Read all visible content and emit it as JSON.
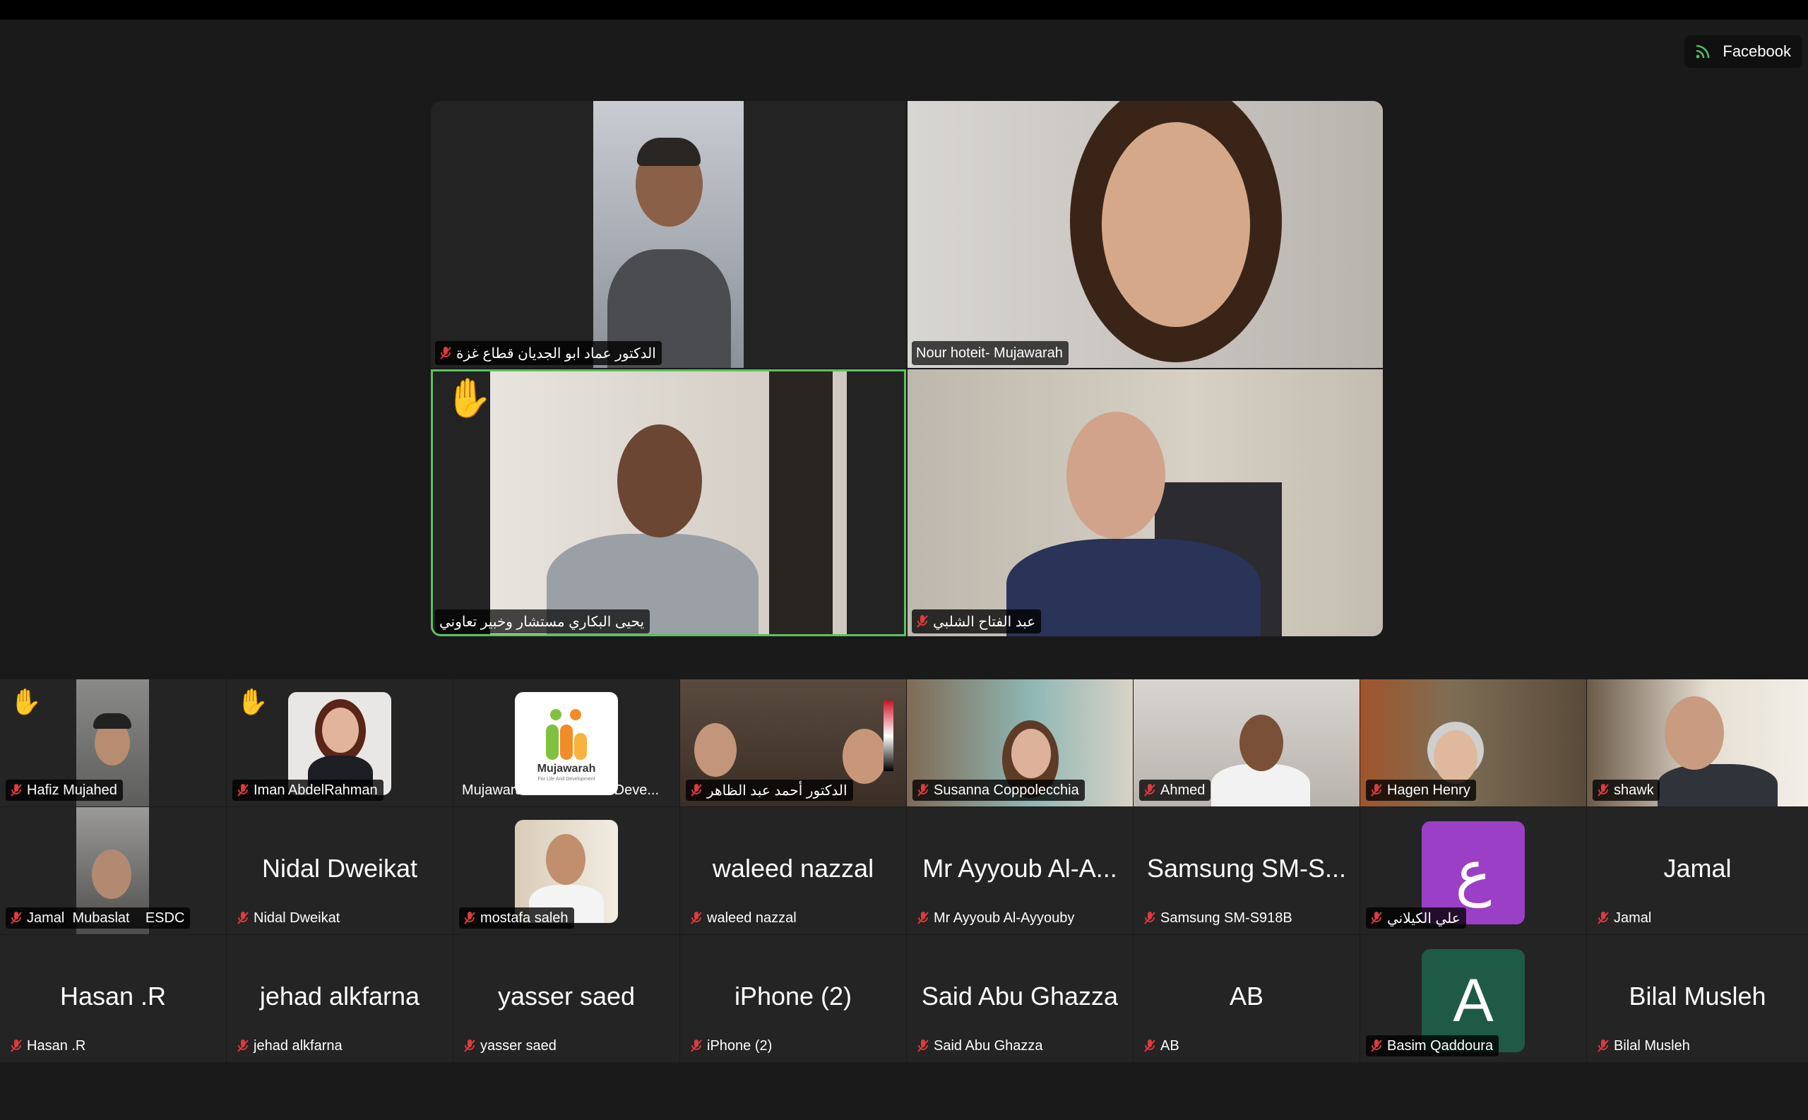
{
  "top_bar": {
    "stream_label": "Facebook",
    "stream_icon": "live-stream-icon"
  },
  "main_gallery": [
    {
      "name": "الدكتور عماد ابو الجديان قطاع غزة",
      "muted": true
    },
    {
      "name": "Nour hoteit- Mujawarah",
      "muted": false
    },
    {
      "name": "يحيى البكاري مستشار وخبير تعاوني",
      "muted": false,
      "hand_raised": true,
      "active_speaker": true
    },
    {
      "name": "عبد الفتاح الشلبي",
      "muted": true
    }
  ],
  "strip_row1": [
    {
      "name": "Hafiz Mujahed",
      "hand_raised": true,
      "muted": true
    },
    {
      "name": "Iman AbdelRahman",
      "hand_raised": true,
      "muted": true
    },
    {
      "name": "Mujawarah For Life and Deve...",
      "muted": false,
      "logo_text": "Mujawarah",
      "logo_sub": "For Life And Development"
    },
    {
      "name": "الدكتور أحمد عبد الظاهر",
      "muted": true
    },
    {
      "name": "Susanna Coppolecchia",
      "muted": true
    },
    {
      "name": "Ahmed",
      "muted": true
    },
    {
      "name": "Hagen Henry",
      "muted": true
    },
    {
      "name": "shawk",
      "muted": true
    }
  ],
  "strip_row2": [
    {
      "name": "Jamal  Mubaslat    ESDC",
      "muted": true
    },
    {
      "display": "Nidal Dweikat",
      "name": "Nidal Dweikat",
      "muted": true
    },
    {
      "name": "mostafa saleh",
      "muted": true
    },
    {
      "display": "waleed nazzal",
      "name": "waleed nazzal",
      "muted": true
    },
    {
      "display": "Mr Ayyoub Al-A...",
      "name": "Mr Ayyoub Al-Ayyouby",
      "muted": true
    },
    {
      "display": "Samsung SM-S...",
      "name": "Samsung SM-S918B",
      "muted": true
    },
    {
      "avatar_letter": "ع",
      "avatar_color": "#9b3fc6",
      "name": "علي الكيلاني",
      "muted": true
    },
    {
      "display": "Jamal",
      "name": "Jamal",
      "muted": true
    }
  ],
  "strip_row3": [
    {
      "display": "Hasan .R",
      "name": "Hasan .R",
      "muted": true
    },
    {
      "display": "jehad alkfarna",
      "name": "jehad alkfarna",
      "muted": true
    },
    {
      "display": "yasser saed",
      "name": "yasser saed",
      "muted": true
    },
    {
      "display": "iPhone (2)",
      "name": "iPhone (2)",
      "muted": true
    },
    {
      "display": "Said Abu Ghazza",
      "name": "Said Abu Ghazza",
      "muted": true
    },
    {
      "display": "AB",
      "name": "AB",
      "muted": true
    },
    {
      "avatar_letter": "A",
      "avatar_color": "#1e5a46",
      "name": "Basim Qaddoura",
      "muted": true
    },
    {
      "display": "Bilal Musleh",
      "name": "Bilal Musleh",
      "muted": true
    }
  ],
  "colors": {
    "active_speaker_border": "#5bc160",
    "muted_icon": "#e0393e",
    "background": "#1a1a1a"
  }
}
